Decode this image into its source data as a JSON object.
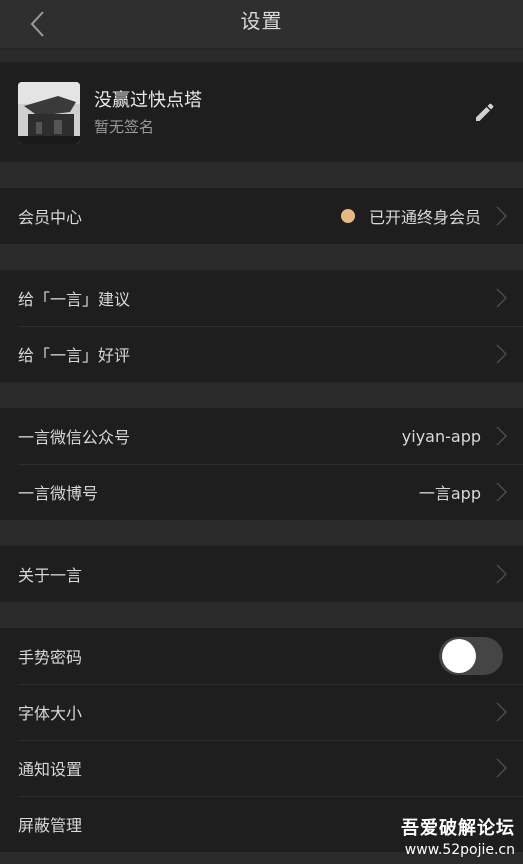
{
  "header": {
    "title": "设置"
  },
  "profile": {
    "name": "没赢过快点塔",
    "signature": "暂无签名"
  },
  "membership": {
    "label": "会员中心",
    "status": "已开通终身会员",
    "dot_color": "#e6b882"
  },
  "feedback": {
    "suggest_label": "给「一言」建议",
    "review_label": "给「一言」好评"
  },
  "social": {
    "wechat_label": "一言微信公众号",
    "wechat_value": "yiyan-app",
    "weibo_label": "一言微博号",
    "weibo_value": "一言app"
  },
  "about": {
    "label": "关于一言"
  },
  "settings": {
    "gesture_label": "手势密码",
    "gesture_enabled": false,
    "font_label": "字体大小",
    "notify_label": "通知设置",
    "block_label": "屏蔽管理"
  },
  "watermark": {
    "title": "吾爱破解论坛",
    "url": "www.52pojie.cn"
  },
  "icons": {
    "back": "chevron-left-icon",
    "edit": "pencil-icon",
    "row_arrow": "chevron-right-icon"
  }
}
